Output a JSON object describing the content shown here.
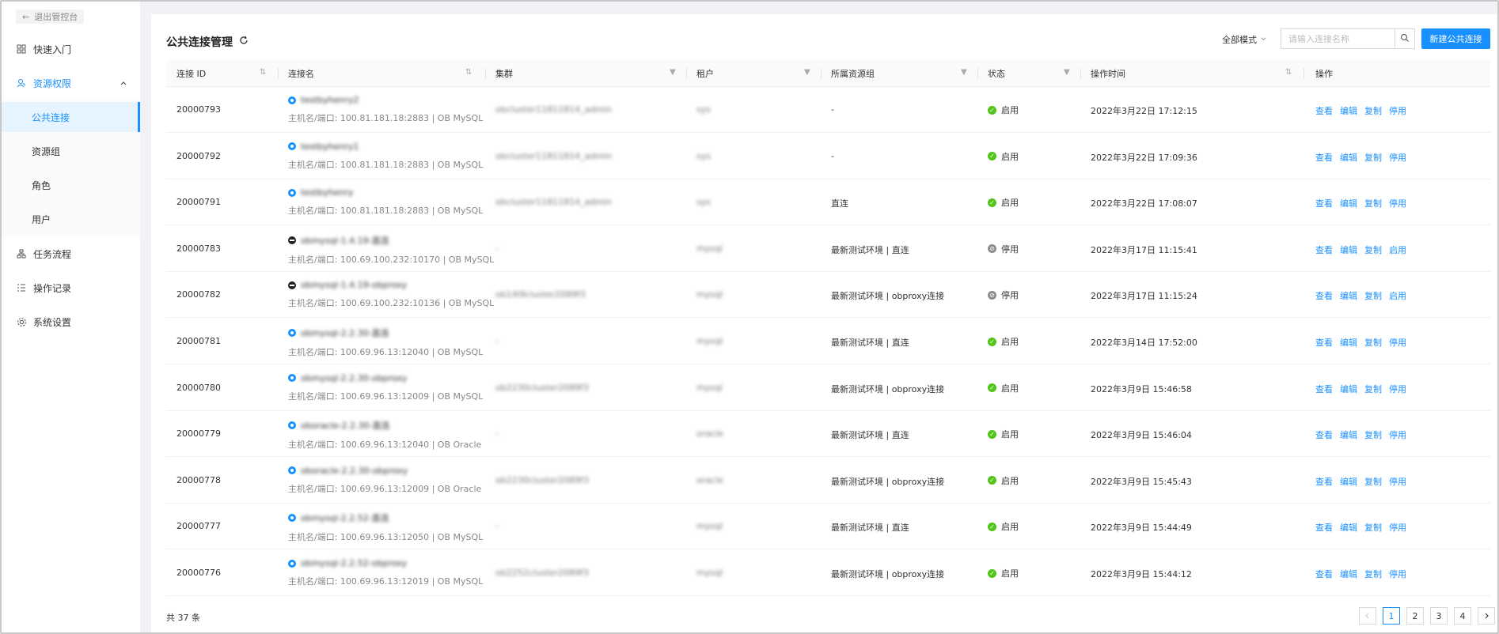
{
  "sidebar": {
    "exit": "退出管控台",
    "items": [
      {
        "label": "快速入门",
        "icon": "dashboard-icon"
      },
      {
        "label": "资源权限",
        "icon": "permission-icon"
      },
      {
        "label": "任务流程",
        "icon": "flow-icon"
      },
      {
        "label": "操作记录",
        "icon": "record-icon"
      },
      {
        "label": "系统设置",
        "icon": "gear-icon"
      }
    ],
    "sub": [
      {
        "label": "公共连接"
      },
      {
        "label": "资源组"
      },
      {
        "label": "角色"
      },
      {
        "label": "用户"
      }
    ]
  },
  "header": {
    "title": "公共连接管理",
    "mode": "全部模式",
    "search_placeholder": "请输入连接名称",
    "new_button": "新建公共连接"
  },
  "table": {
    "columns": [
      "连接 ID",
      "连接名",
      "集群",
      "租户",
      "所属资源组",
      "状态",
      "操作时间",
      "操作"
    ],
    "rows": [
      {
        "id": "20000793",
        "name": "testbyhenry2",
        "host": "主机名/端口: 100.81.181.18:2883 | OB MySQL",
        "cluster": "obcluster11811814_admin",
        "tenant": "sys",
        "group": "-",
        "status": "启用",
        "on": true,
        "time": "2022年3月22日 17:12:15",
        "actions": [
          "查看",
          "编辑",
          "复制",
          "停用"
        ]
      },
      {
        "id": "20000792",
        "name": "testbyhenry1",
        "host": "主机名/端口: 100.81.181.18:2883 | OB MySQL",
        "cluster": "obcluster11811814_admin",
        "tenant": "sys",
        "group": "-",
        "status": "启用",
        "on": true,
        "time": "2022年3月22日 17:09:36",
        "actions": [
          "查看",
          "编辑",
          "复制",
          "停用"
        ]
      },
      {
        "id": "20000791",
        "name": "testbyhenry",
        "host": "主机名/端口: 100.81.181.18:2883 | OB MySQL",
        "cluster": "obcluster11811814_admin",
        "tenant": "sys",
        "group": "直连",
        "status": "启用",
        "on": true,
        "time": "2022年3月22日 17:08:07",
        "actions": [
          "查看",
          "编辑",
          "复制",
          "停用"
        ]
      },
      {
        "id": "20000783",
        "name": "obmysql-1.4.19-直连",
        "host": "主机名/端口: 100.69.100.232:10170 | OB MySQL",
        "cluster": "-",
        "tenant": "mysql",
        "group": "最新测试环境 | 直连",
        "status": "停用",
        "on": false,
        "time": "2022年3月17日 11:15:41",
        "actions": [
          "查看",
          "编辑",
          "复制",
          "启用"
        ]
      },
      {
        "id": "20000782",
        "name": "obmysql-1.4.19-obproxy",
        "host": "主机名/端口: 100.69.100.232:10136 | OB MySQL",
        "cluster": "ob14l9cluster2089f3",
        "tenant": "mysql",
        "group": "最新测试环境 | obproxy连接",
        "status": "停用",
        "on": false,
        "time": "2022年3月17日 11:15:24",
        "actions": [
          "查看",
          "编辑",
          "复制",
          "启用"
        ]
      },
      {
        "id": "20000781",
        "name": "obmysql-2.2.30-直连",
        "host": "主机名/端口: 100.69.96.13:12040 | OB MySQL",
        "cluster": "-",
        "tenant": "mysql",
        "group": "最新测试环境 | 直连",
        "status": "启用",
        "on": true,
        "time": "2022年3月14日 17:52:00",
        "actions": [
          "查看",
          "编辑",
          "复制",
          "停用"
        ]
      },
      {
        "id": "20000780",
        "name": "obmysql-2.2.30-obproxy",
        "host": "主机名/端口: 100.69.96.13:12009 | OB MySQL",
        "cluster": "ob2230cluster2089f3",
        "tenant": "mysql",
        "group": "最新测试环境 | obproxy连接",
        "status": "启用",
        "on": true,
        "time": "2022年3月9日 15:46:58",
        "actions": [
          "查看",
          "编辑",
          "复制",
          "停用"
        ]
      },
      {
        "id": "20000779",
        "name": "oboracle-2.2.30-直连",
        "host": "主机名/端口: 100.69.96.13:12040 | OB Oracle",
        "cluster": "-",
        "tenant": "oracle",
        "group": "最新测试环境 | 直连",
        "status": "启用",
        "on": true,
        "time": "2022年3月9日 15:46:04",
        "actions": [
          "查看",
          "编辑",
          "复制",
          "停用"
        ]
      },
      {
        "id": "20000778",
        "name": "oboracle-2.2.30-obproxy",
        "host": "主机名/端口: 100.69.96.13:12009 | OB Oracle",
        "cluster": "ob2230cluster2089f3",
        "tenant": "oracle",
        "group": "最新测试环境 | obproxy连接",
        "status": "启用",
        "on": true,
        "time": "2022年3月9日 15:45:43",
        "actions": [
          "查看",
          "编辑",
          "复制",
          "停用"
        ]
      },
      {
        "id": "20000777",
        "name": "obmysql-2.2.52-直连",
        "host": "主机名/端口: 100.69.96.13:12050 | OB MySQL",
        "cluster": "-",
        "tenant": "mysql",
        "group": "最新测试环境 | 直连",
        "status": "启用",
        "on": true,
        "time": "2022年3月9日 15:44:49",
        "actions": [
          "查看",
          "编辑",
          "复制",
          "停用"
        ]
      },
      {
        "id": "20000776",
        "name": "obmysql-2.2.52-obproxy",
        "host": "主机名/端口: 100.69.96.13:12019 | OB MySQL",
        "cluster": "ob2252cluster2089f3",
        "tenant": "mysql",
        "group": "最新测试环境 | obproxy连接",
        "status": "启用",
        "on": true,
        "time": "2022年3月9日 15:44:12",
        "actions": [
          "查看",
          "编辑",
          "复制",
          "停用"
        ]
      }
    ]
  },
  "footer": {
    "total": "共 37 条",
    "pages": [
      "1",
      "2",
      "3",
      "4"
    ],
    "current_page": "1"
  },
  "colors": {
    "accent": "#1890ff",
    "ok": "#52c41a",
    "off": "#8c8c8c"
  }
}
